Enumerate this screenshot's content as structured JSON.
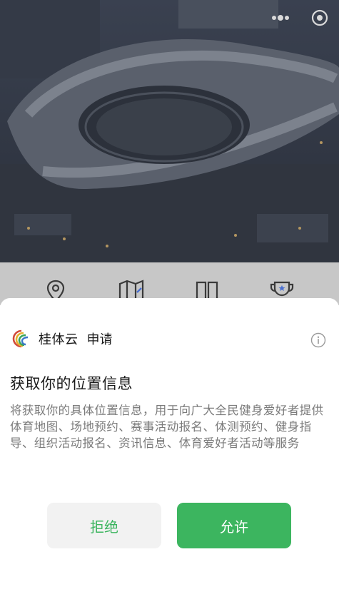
{
  "colors": {
    "accent_green": "#3cb55f",
    "deny_bg": "#f2f2f2",
    "text_primary": "#1a1a1a",
    "text_secondary": "#7b7b7b"
  },
  "capsule": {
    "more_icon": "more-dots-icon",
    "close_icon": "record-close-icon"
  },
  "quicknav": {
    "items": [
      {
        "icon": "map-pin-icon"
      },
      {
        "icon": "map-fold-icon"
      },
      {
        "icon": "book-icon"
      },
      {
        "icon": "trophy-icon"
      }
    ]
  },
  "sheet": {
    "app_name": "桂体云",
    "request_label": "申请",
    "title": "获取你的位置信息",
    "description": "将获取你的具体位置信息，用于向广大全民健身爱好者提供体育地图、场地预约、赛事活动报名、体测预约、健身指导、组织活动报名、资讯信息、体育爱好者活动等服务",
    "deny_label": "拒绝",
    "allow_label": "允许"
  }
}
